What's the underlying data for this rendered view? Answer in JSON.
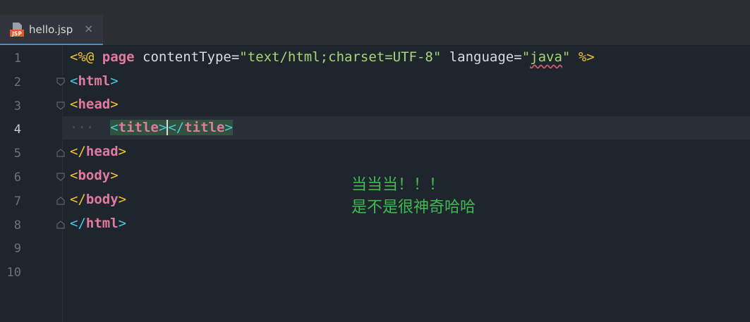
{
  "tab": {
    "label": "hello.jsp",
    "close_glyph": "×",
    "icon": "jsp-file-icon",
    "icon_text": "JSP"
  },
  "gutter": {
    "line_numbers": [
      "1",
      "2",
      "3",
      "4",
      "5",
      "6",
      "7",
      "8",
      "9",
      "10"
    ],
    "current_line": "4"
  },
  "code": {
    "line1": {
      "open": "<%@",
      "directive": "page",
      "attr1": "contentType",
      "eq1": "=",
      "val1": "\"text/html;charset=UTF-8\"",
      "attr2": "language",
      "eq2": "=",
      "val2_q1": "\"",
      "val2_word": "java",
      "val2_q2": "\"",
      "close": "%>"
    },
    "line2": {
      "lt": "<",
      "tag": "html",
      "gt": ">"
    },
    "line3": {
      "lt": "<",
      "tag": "head",
      "gt": ">"
    },
    "line4": {
      "indent": "···",
      "lt1": "<",
      "tag1": "title",
      "gt1": ">",
      "lt2": "</",
      "tag2": "title",
      "gt2": ">"
    },
    "line5": {
      "lt": "</",
      "tag": "head",
      "gt": ">"
    },
    "line6": {
      "lt": "<",
      "tag": "body",
      "gt": ">"
    },
    "line7": {
      "lt": "</",
      "tag": "body",
      "gt": ">"
    },
    "line8": {
      "lt": "</",
      "tag": "html",
      "gt": ">"
    }
  },
  "annotation": {
    "line1": "当当当！！！",
    "line2": "是不是很神奇哈哈"
  },
  "colors": {
    "annotation": "#3fb950",
    "tag": "#e07aa0",
    "delimiter": "#f1c232",
    "string": "#a7d676",
    "html_bracket": "#49c8e0"
  }
}
